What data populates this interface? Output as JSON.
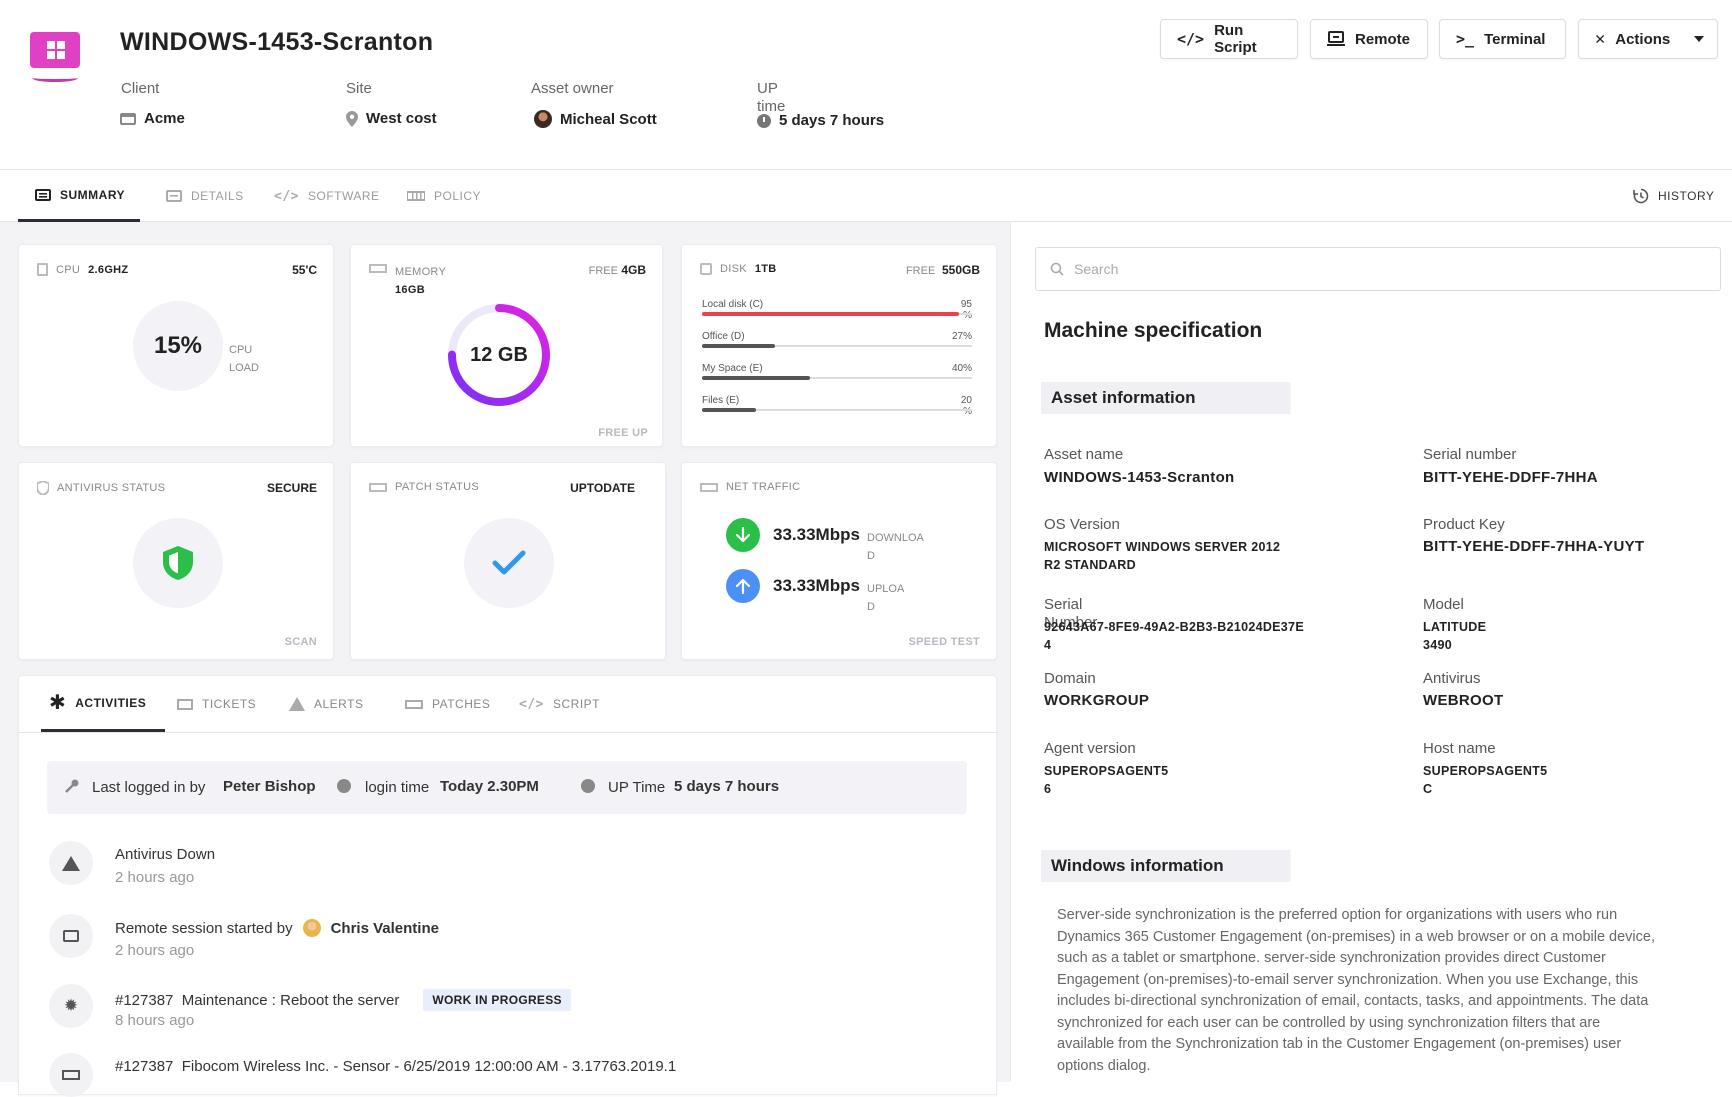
{
  "header": {
    "title": "WINDOWS-1453-Scranton",
    "client_label": "Client",
    "client_value": "Acme",
    "site_label": "Site",
    "site_value": "West cost",
    "owner_label": "Asset owner",
    "owner_value": "Micheal Scott",
    "uptime_label_1": "UP",
    "uptime_label_2": "time",
    "uptime_value": "5 days 7 hours",
    "buttons": {
      "run_script": "Run Script",
      "remote": "Remote",
      "terminal": "Terminal",
      "actions": "Actions"
    }
  },
  "tabs": {
    "summary": "SUMMARY",
    "details": "DETAILS",
    "software": "SOFTWARE",
    "policy": "POLICY",
    "history": "HISTORY"
  },
  "cards": {
    "cpu": {
      "label": "CPU",
      "speed": "2.6GHZ",
      "temp": "55'C",
      "load": "15%",
      "load_label_1": "CPU",
      "load_label_2": "LOAD"
    },
    "memory": {
      "label": "MEMORY",
      "total": "16GB",
      "free_label": "FREE",
      "free_value": "4GB",
      "used": "12 GB",
      "footer": "FREE UP",
      "used_fraction": 0.75
    },
    "disk": {
      "label": "DISK",
      "total": "1TB",
      "free_label": "FREE",
      "free_value": "550GB",
      "drives": [
        {
          "name": "Local disk (C)",
          "percent": "95\n%",
          "fraction": 0.95,
          "color": "#e8424b"
        },
        {
          "name": "Office (D)",
          "percent": "27%",
          "fraction": 0.27,
          "color": "#555555"
        },
        {
          "name": "My Space (E)",
          "percent": "40%",
          "fraction": 0.4,
          "color": "#555555"
        },
        {
          "name": "Files (E)",
          "percent": "20\n%",
          "fraction": 0.2,
          "color": "#555555"
        }
      ]
    },
    "antivirus": {
      "label": "ANTIVIRUS STATUS",
      "status": "SECURE",
      "footer": "SCAN"
    },
    "patch": {
      "label": "PATCH STATUS",
      "status": "UPTODATE"
    },
    "net": {
      "label": "NET TRAFFIC",
      "down": "33.33Mbps",
      "down_label": "DOWNLOA\nD",
      "up": "33.33Mbps",
      "up_label": "UPLOA\nD",
      "footer": "SPEED TEST"
    }
  },
  "activity_tabs": {
    "activities": "ACTIVITIES",
    "tickets": "TICKETS",
    "alerts": "ALERTS",
    "patches": "PATCHES",
    "script": "SCRIPT"
  },
  "login_bar": {
    "last_label": "Last logged in by",
    "last_value": "Peter Bishop",
    "login_label": "login time",
    "login_value": "Today 2.30PM",
    "up_label": "UP Time",
    "up_value": "5 days 7 hours"
  },
  "activities": [
    {
      "text": "Antivirus Down",
      "time": "2 hours ago"
    },
    {
      "text": "Remote session started by",
      "user": "Chris Valentine",
      "time": "2 hours ago"
    },
    {
      "text": "#127387  Maintenance : Reboot the server",
      "badge": "WORK IN PROGRESS",
      "time": "8 hours ago"
    },
    {
      "text": "#127387  Fibocom Wireless Inc. - Sensor - 6/25/2019 12:00:00 AM - 3.17763.2019.1"
    }
  ],
  "right": {
    "search_placeholder": "Search",
    "spec_title": "Machine specification",
    "asset_info_title": "Asset information",
    "fields": {
      "asset_name_label": "Asset name",
      "asset_name": "WINDOWS-1453-Scranton",
      "serial_label": "Serial number",
      "serial": "BITT-YEHE-DDFF-7HHA",
      "os_label": "OS Version",
      "os": "MICROSOFT WINDOWS SERVER 2012\nR2 STANDARD",
      "product_key_label": "Product Key",
      "product_key": "BITT-YEHE-DDFF-7HHA-YUYT",
      "serial_num_label": "Serial\nNumber",
      "serial_num": "92643A67-8FE9-49A2-B2B3-B21024DE37E\n4",
      "model_label": "Model",
      "model": "LATITUDE\n3490",
      "domain_label": "Domain",
      "domain": "WORKGROUP",
      "antivirus_label": "Antivirus",
      "antivirus": "WEBROOT",
      "agent_label": "Agent version",
      "agent": "SUPEROPSAGENT5\n6",
      "host_label": "Host name",
      "host": "SUPEROPSAGENT5\nC"
    },
    "windows_info_title": "Windows information",
    "windows_info_text": "Server-side synchronization is the preferred option for organizations with users who run Dynamics 365 Customer Engagement (on-premises) in a web browser or on a mobile device, such as a tablet or smartphone. server-side synchronization provides direct Customer Engagement (on-premises)-to-email server synchronization. When you use Exchange, this includes bi-directional synchronization of email, contacts, tasks, and appointments. The data synchronized for each user can be controlled by using synchronization filters that are available from the Synchronization tab in the Customer Engagement (on-premises) user options dialog."
  },
  "colors": {
    "accent": "#c424f0",
    "down": "#2bbf4a",
    "up": "#4c8ff5",
    "danger": "#e8424b",
    "shield": "#2bbf4a",
    "check": "#3399e6"
  }
}
